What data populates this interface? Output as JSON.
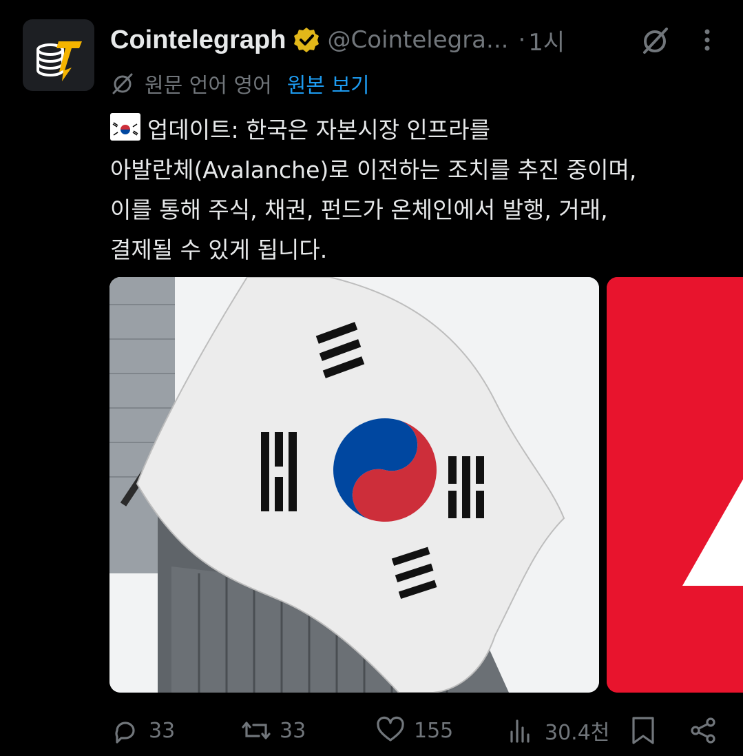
{
  "author": {
    "name": "Cointelegraph",
    "handle": "@Cointelegra...",
    "separator": "·",
    "time": "1시",
    "brand_color": "#f5b400",
    "icons": [
      "verified-badge-icon",
      "grok-icon",
      "more-icon"
    ]
  },
  "translation": {
    "label": "원문 언어 영어",
    "show_original": "원본 보기",
    "link_color": "#1d9bf0"
  },
  "tweet": {
    "flag_emoji": "kr-flag-emoji",
    "lines": [
      "업데이트: 한국은 자본시장 인프라를",
      "아발란체(Avalanche)로 이전하는 조치를 추진 중이며,",
      "이를 통해 주식, 채권, 펀드가 온체인에서 발행, 거래,",
      "결제될 수 있게 됩니다."
    ]
  },
  "media": [
    {
      "description_icon": "korean-flag-photo"
    },
    {
      "description_icon": "avalanche-logo-photo",
      "color": "#e8142d"
    }
  ],
  "actions": {
    "replies": "33",
    "reposts": "33",
    "likes": "155",
    "views": "30.4천",
    "icons": [
      "reply-icon",
      "repost-icon",
      "like-icon",
      "views-icon",
      "bookmark-icon",
      "share-icon"
    ]
  }
}
